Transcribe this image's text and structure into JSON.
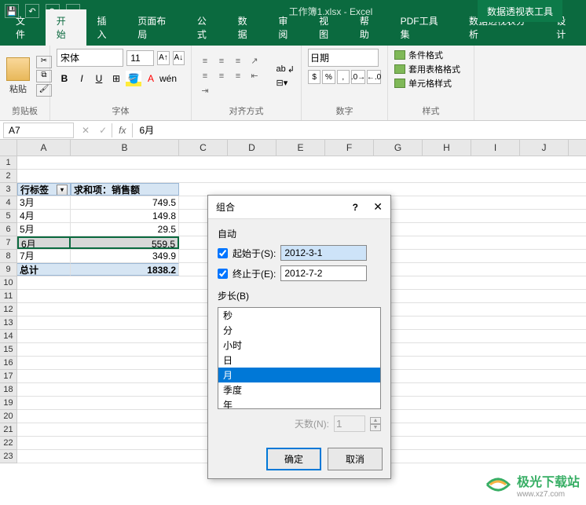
{
  "titlebar": {
    "title": "工作簿1.xlsx - Excel",
    "pivot_tools": "数据透视表工具"
  },
  "tabs": {
    "file": "文件",
    "home": "开始",
    "insert": "插入",
    "page_layout": "页面布局",
    "formulas": "公式",
    "data": "数据",
    "review": "审阅",
    "view": "视图",
    "help": "帮助",
    "pdf": "PDF工具集",
    "pivot_analyze": "数据透视表分析",
    "design": "设计"
  },
  "ribbon": {
    "clipboard": {
      "paste": "粘贴",
      "label": "剪贴板"
    },
    "font": {
      "name": "宋体",
      "size": "11",
      "label": "字体"
    },
    "alignment": {
      "wrap": "ab",
      "merge": "—",
      "label": "对齐方式"
    },
    "number": {
      "format": "日期",
      "label": "数字"
    },
    "styles": {
      "cond": "条件格式",
      "table": "套用表格格式",
      "cell": "单元格样式",
      "label": "样式"
    }
  },
  "formula_bar": {
    "name_box": "A7",
    "fx": "fx",
    "value": "6月"
  },
  "columns": [
    "A",
    "B",
    "C",
    "D",
    "E",
    "F",
    "G",
    "H",
    "I",
    "J"
  ],
  "row_nums": [
    "1",
    "2",
    "3",
    "4",
    "5",
    "6",
    "7",
    "8",
    "9",
    "10",
    "11",
    "12",
    "13",
    "14",
    "15",
    "16",
    "17",
    "18",
    "19",
    "20",
    "21",
    "22",
    "23"
  ],
  "pivot": {
    "row_label_header": "行标签",
    "value_header": "求和项：销售额",
    "rows": [
      {
        "label": "3月",
        "value": "749.5"
      },
      {
        "label": "4月",
        "value": "149.8"
      },
      {
        "label": "5月",
        "value": "29.5"
      },
      {
        "label": "6月",
        "value": "559.5"
      },
      {
        "label": "7月",
        "value": "349.9"
      }
    ],
    "total_label": "总计",
    "total_value": "1838.2"
  },
  "dialog": {
    "title": "组合",
    "auto_label": "自动",
    "start_label": "起始于(S):",
    "start_value": "2012-3-1",
    "end_label": "终止于(E):",
    "end_value": "2012-7-2",
    "step_label": "步长(B)",
    "step_options": [
      "秒",
      "分",
      "小时",
      "日",
      "月",
      "季度",
      "年"
    ],
    "step_selected": "月",
    "days_label": "天数(N):",
    "days_value": "1",
    "ok": "确定",
    "cancel": "取消"
  },
  "watermark": {
    "cn": "极光下载站",
    "url": "www.xz7.com"
  }
}
